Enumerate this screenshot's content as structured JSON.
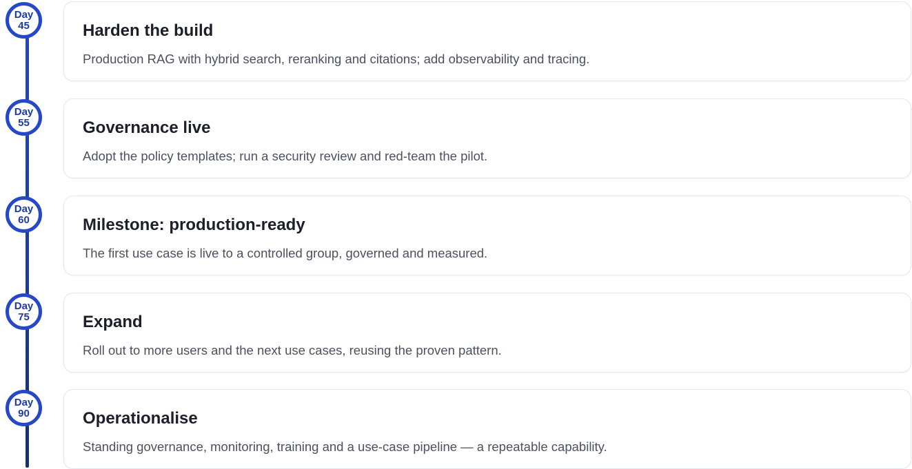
{
  "milestones": [
    {
      "day_label": "Day",
      "day_number": "45",
      "title": "Harden the build",
      "description": "Production RAG with hybrid search, reranking and citations; add observability and tracing."
    },
    {
      "day_label": "Day",
      "day_number": "55",
      "title": "Governance live",
      "description": "Adopt the policy templates; run a security review and red-team the pilot."
    },
    {
      "day_label": "Day",
      "day_number": "60",
      "title": "Milestone: production-ready",
      "description": "The first use case is live to a controlled group, governed and measured."
    },
    {
      "day_label": "Day",
      "day_number": "75",
      "title": "Expand",
      "description": "Roll out to more users and the next use cases, reusing the proven pattern."
    },
    {
      "day_label": "Day",
      "day_number": "90",
      "title": "Operationalise",
      "description": "Standing governance, monitoring, training and a use-case pipeline — a repeatable capability."
    }
  ],
  "colors": {
    "accent": "#2448c6",
    "accent_dark": "#18306f",
    "card_border": "#e3e6ec",
    "title_text": "#1b1f2a",
    "body_text": "#4b5160"
  }
}
